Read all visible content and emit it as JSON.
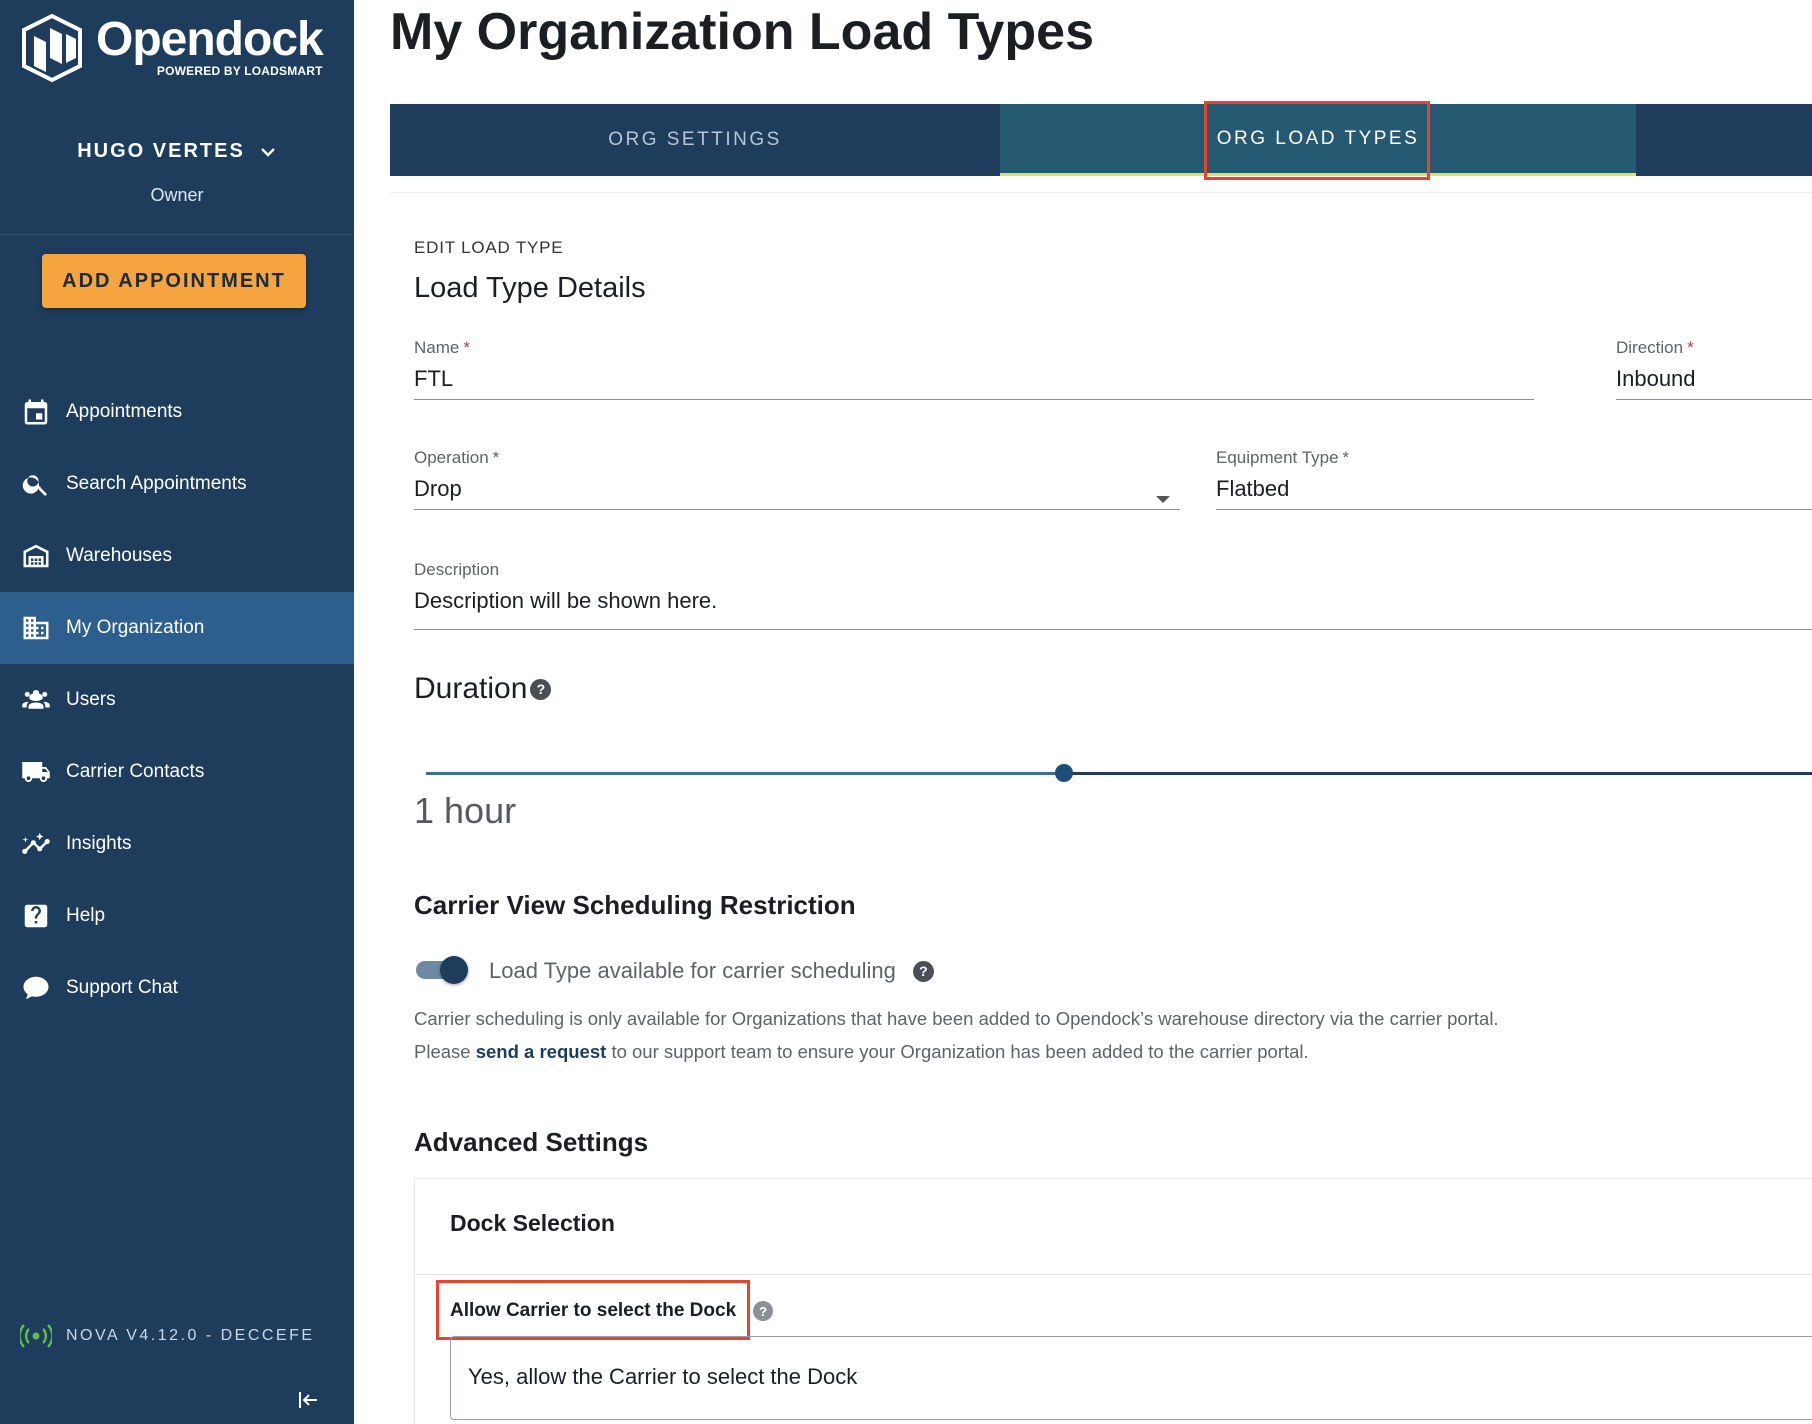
{
  "brand": {
    "name": "Opendock",
    "tagline": "POWERED BY LOADSMART"
  },
  "user": {
    "name": "HUGO VERTES",
    "role": "Owner"
  },
  "sidebar": {
    "add_appointment": "ADD APPOINTMENT",
    "items": [
      {
        "label": "Appointments",
        "icon": "calendar-icon"
      },
      {
        "label": "Search Appointments",
        "icon": "search-icon"
      },
      {
        "label": "Warehouses",
        "icon": "warehouse-icon"
      },
      {
        "label": "My Organization",
        "icon": "building-icon",
        "active": true
      },
      {
        "label": "Users",
        "icon": "users-icon"
      },
      {
        "label": "Carrier Contacts",
        "icon": "truck-icon"
      },
      {
        "label": "Insights",
        "icon": "insights-icon"
      },
      {
        "label": "Help",
        "icon": "help-icon"
      },
      {
        "label": "Support Chat",
        "icon": "chat-icon"
      }
    ],
    "version": "NOVA V4.12.0 - DECCEFE"
  },
  "page": {
    "title": "My Organization Load Types"
  },
  "tabs": {
    "settings": "ORG SETTINGS",
    "load_types": "ORG LOAD TYPES",
    "active": "load_types"
  },
  "form": {
    "overline": "EDIT LOAD TYPE",
    "title": "Load Type Details",
    "name": {
      "label": "Name",
      "value": "FTL"
    },
    "direction": {
      "label": "Direction",
      "value": "Inbound"
    },
    "operation": {
      "label": "Operation",
      "value": "Drop"
    },
    "equipment": {
      "label": "Equipment Type",
      "value": "Flatbed"
    },
    "description": {
      "label": "Description",
      "value": "Description will be shown here."
    },
    "duration": {
      "label": "Duration",
      "value": "1 hour"
    },
    "carrier_restriction": {
      "title": "Carrier View Scheduling Restriction",
      "toggle_label": "Load Type available for carrier scheduling",
      "toggle_on": true,
      "note_line1": "Carrier scheduling is only available for Organizations that have been added to Opendock’s warehouse directory via the carrier portal.",
      "note_prefix": "Please",
      "note_link": "send a request",
      "note_suffix": "to our support team to ensure your Organization has been added to the carrier portal."
    },
    "advanced": {
      "title": "Advanced Settings",
      "dock_title": "Dock Selection",
      "allow_label": "Allow Carrier to select the Dock",
      "allow_value": "Yes, allow the Carrier to select the Dock"
    }
  },
  "colors": {
    "sidebar": "#1e3d5c",
    "accent": "#f6a43f",
    "active_tab": "#255a72",
    "highlight": "#e3452f"
  }
}
